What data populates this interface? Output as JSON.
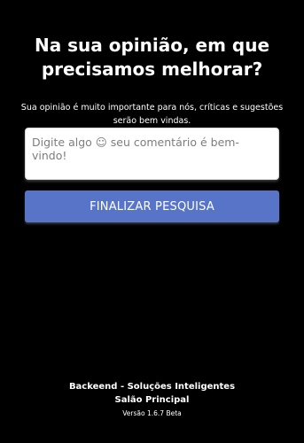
{
  "survey": {
    "question": "Na sua opinião, em que precisamos melhorar?",
    "description": "Sua opinião é muito importante para nós, críticas e sugestões serão bem vindas.",
    "comment_placeholder": "Digite algo ☺ seu comentário é bem-vindo!",
    "comment_value": "",
    "submit_label": "FINALIZAR PESQUISA",
    "accent_color": "#5874c8"
  },
  "footer": {
    "company": "Backeend - Soluções Inteligentes",
    "location": "Salão Principal",
    "version": "Versão 1.6.7 Beta"
  }
}
